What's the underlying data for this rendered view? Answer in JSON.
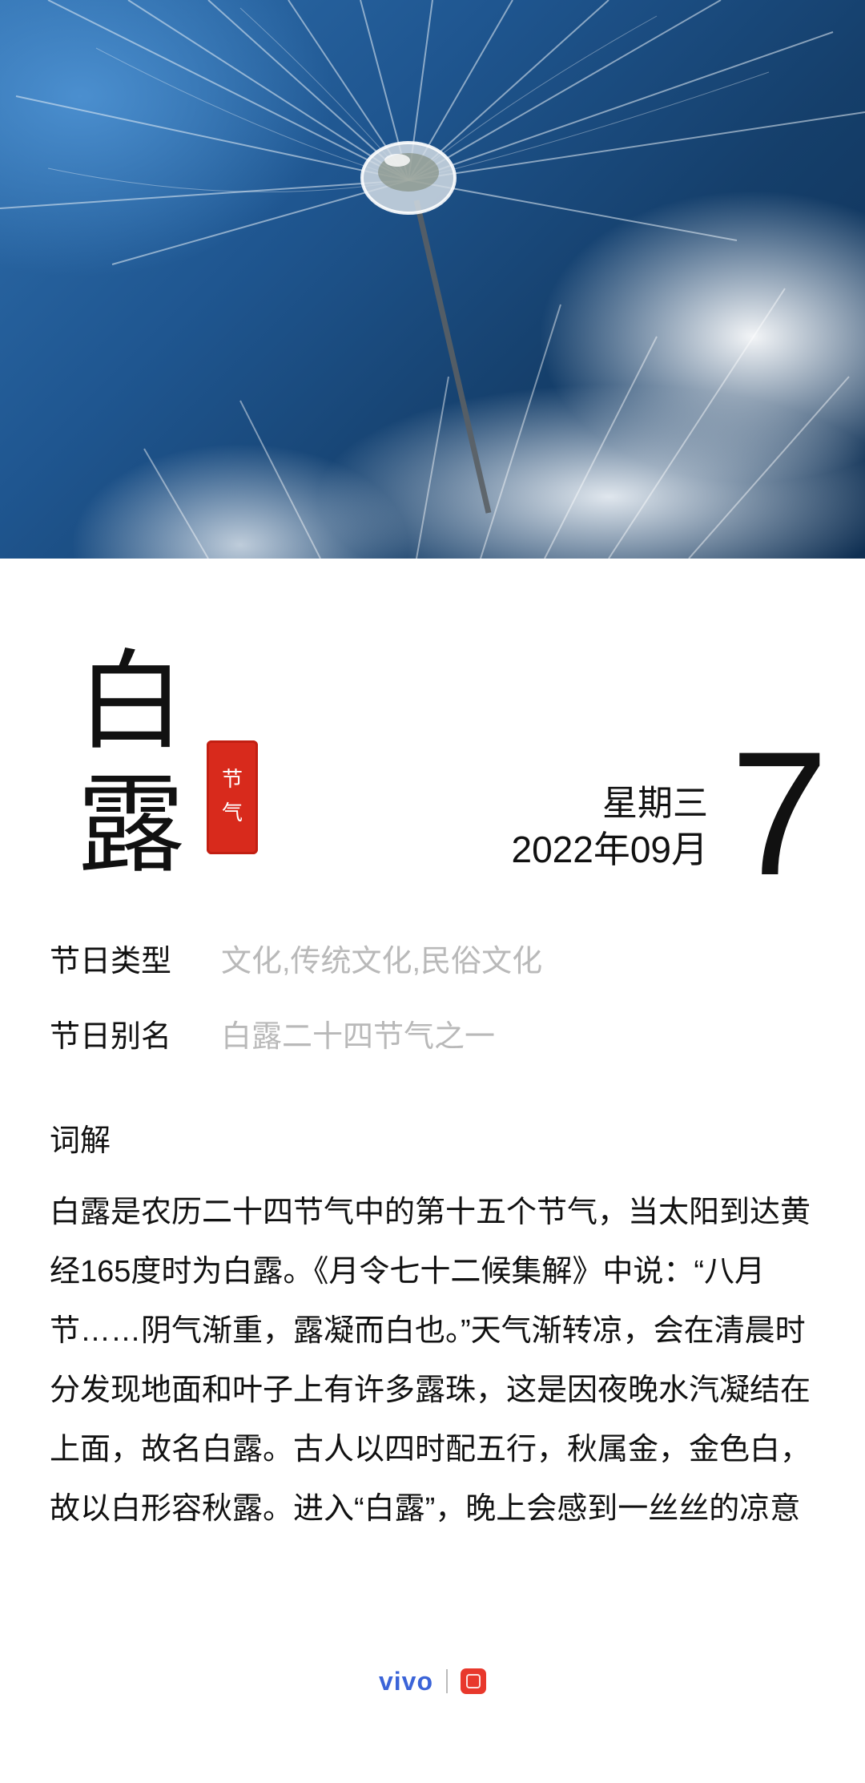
{
  "hero": {
    "image": "dandelion-seed-dewdrop-photo"
  },
  "term": {
    "char1": "白",
    "char2": "露"
  },
  "seal": {
    "line1": "节",
    "line2": "气"
  },
  "date": {
    "weekday": "星期三",
    "year_month": "2022年09月",
    "day": "7"
  },
  "info": {
    "type_label": "节日类型",
    "type_value": "文化,传统文化,民俗文化",
    "alias_label": "节日别名",
    "alias_value": "白露二十四节气之一"
  },
  "section": {
    "title": "词解"
  },
  "description": "白露是农历二十四节气中的第十五个节气，当太阳到达黄经165度时为白露。《月令七十二候集解》中说：“八月节……阴气渐重，露凝而白也。”天气渐转凉，会在清晨时分发现地面和叶子上有许多露珠，这是因夜晚水汽凝结在上面，故名白露。古人以四时配五行，秋属金，金色白，故以白形容秋露。进入“白露”，晚上会感到一丝丝的凉意",
  "footer": {
    "brand": "vivo",
    "app_icon": "calendar-app-icon"
  },
  "colors": {
    "seal": "#d82a1c",
    "brand": "#3b64d8",
    "muted": "#b9b9b9"
  }
}
